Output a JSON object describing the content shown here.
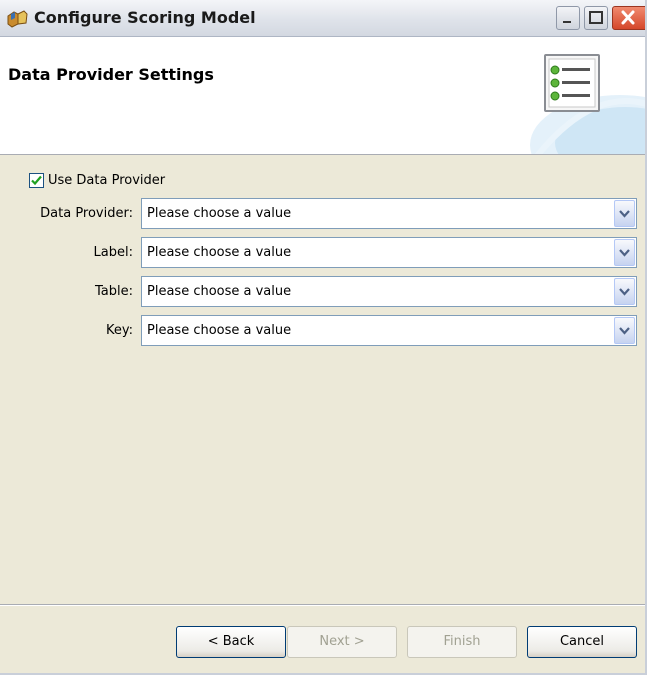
{
  "window": {
    "title": "Configure Scoring Model",
    "controls": {
      "minimize": "minimize",
      "maximize": "maximize",
      "close": "close"
    }
  },
  "header": {
    "title": "Data Provider Settings",
    "icon": "settings-list-icon"
  },
  "form": {
    "use_provider": {
      "label": "Use Data Provider",
      "checked": true
    },
    "fields": [
      {
        "label": "Data Provider:",
        "value": "Please choose a value"
      },
      {
        "label": "Label:",
        "value": "Please choose a value"
      },
      {
        "label": "Table:",
        "value": "Please choose a value"
      },
      {
        "label": "Key:",
        "value": "Please choose a value"
      }
    ]
  },
  "buttons": {
    "back": {
      "label": "< Back",
      "enabled": true
    },
    "next": {
      "label": "Next >",
      "enabled": false
    },
    "finish": {
      "label": "Finish",
      "enabled": false
    },
    "cancel": {
      "label": "Cancel",
      "enabled": true
    }
  },
  "colors": {
    "accent": "#3b8a2a",
    "titlebar": "#dfe3ea",
    "close_button": "#d5472a",
    "header_deco": "#cfe6f5"
  }
}
